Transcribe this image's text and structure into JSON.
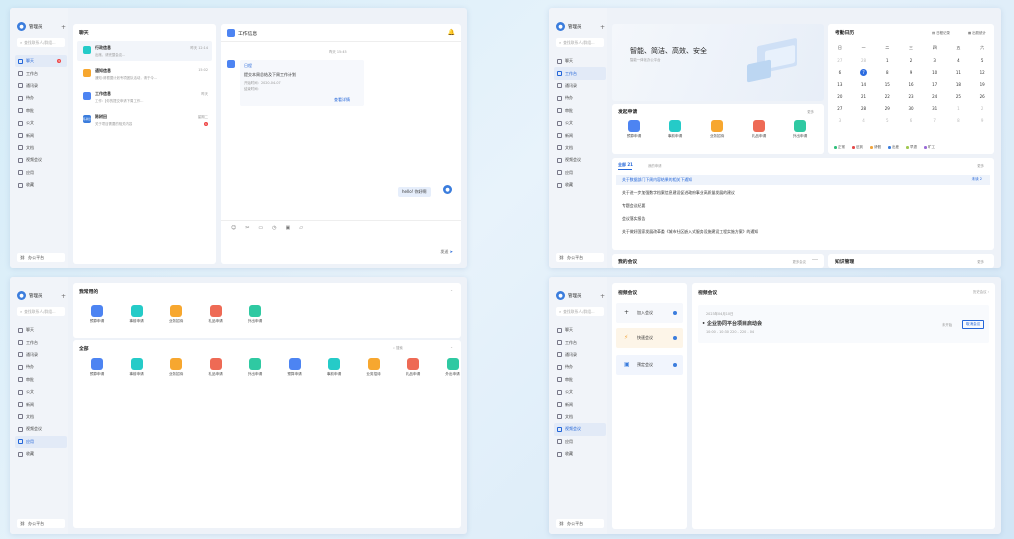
{
  "sidebar": {
    "user": "管理员",
    "search_placeholder": "查找联系人/群组...",
    "items": [
      "聊天",
      "工作台",
      "通讯录",
      "待办",
      "审批",
      "公文",
      "新闻",
      "文档",
      "视频会议",
      "应用",
      "收藏"
    ],
    "chat_badge": "3",
    "footer": "办公平台"
  },
  "chat": {
    "panel_title": "聊天",
    "list": [
      {
        "name": "行政信息",
        "preview": "出席，请完整会议...",
        "time": "昨天 12:14"
      },
      {
        "name": "通知信息",
        "preview": "通知:请根据计划专项团队活动，请于今...",
        "time": "15:02"
      },
      {
        "name": "工作信息",
        "preview": "工作:【你的提交申请下周工作...",
        "time": "昨天"
      },
      {
        "name": "陈树田",
        "preview": "关于项目需要的相关内容",
        "time": "星期二",
        "avatar": "陈树田",
        "badge": "1"
      }
    ],
    "conv_title": "工作信息",
    "timestamp": "昨天 15:45",
    "card": {
      "tag": "日程",
      "title": "提交本周总结及下周工作计划",
      "start": "开始时间：2020-04-07",
      "end": "结束时间:",
      "link": "查看详情"
    },
    "my_msg": "hello! 你好啊",
    "send": "发送"
  },
  "workbench": {
    "banner_title": "智能、简洁、高效、安全",
    "banner_sub": "智能一体化办公平台",
    "apply_title": "发起申请",
    "more": "更多",
    "apps": [
      "预算申请",
      "事前申请",
      "业务招待",
      "礼品申请",
      "外出申请"
    ],
    "calendar_title": "考勤日历",
    "cal_btn1": "日程记录",
    "cal_btn2": "出勤统计",
    "weekdays": [
      "日",
      "一",
      "二",
      "三",
      "四",
      "五",
      "六"
    ],
    "weeks": [
      [
        "27",
        "28",
        "1",
        "2",
        "3",
        "4",
        "5"
      ],
      [
        "6",
        "7",
        "8",
        "9",
        "10",
        "11",
        "12"
      ],
      [
        "13",
        "14",
        "15",
        "16",
        "17",
        "18",
        "19"
      ],
      [
        "20",
        "21",
        "22",
        "23",
        "24",
        "25",
        "26"
      ],
      [
        "27",
        "28",
        "29",
        "30",
        "31",
        "1",
        "2"
      ],
      [
        "3",
        "4",
        "5",
        "6",
        "7",
        "8",
        "9"
      ]
    ],
    "today": "7",
    "legend": [
      {
        "label": "正常",
        "color": "#2fbf7a"
      },
      {
        "label": "迟到",
        "color": "#e44a4a"
      },
      {
        "label": "请假",
        "color": "#f0a33a"
      },
      {
        "label": "出差",
        "color": "#3b7ddd"
      },
      {
        "label": "早退",
        "color": "#a0c850"
      },
      {
        "label": "旷工",
        "color": "#9a6bd8"
      }
    ],
    "tabs": [
      "全部 21",
      "我的申请"
    ],
    "announcements": [
      "关于数据部门下周内容结果的相关下通知",
      "关于进一步加强数字档案信息建设促进政府事业高质量发展的建议",
      "专题会议纪要",
      "会议落实报告",
      "关于做好国家发展改革委《城市社区嵌入式服务设施建设工程实施方案》的通知"
    ],
    "unread": "未读 2",
    "meeting_title": "我的会议",
    "meeting_more": "更多会议",
    "knowledge_title": "知识管理"
  },
  "apps_window": {
    "frequent_title": "我常用的",
    "frequent": [
      "预算申请",
      "事前申请",
      "业务招待",
      "礼品申请",
      "外出申请"
    ],
    "all_title": "全部",
    "all_search": "搜索",
    "all": [
      "预算申请",
      "事前申请",
      "业务招待",
      "礼品申请",
      "外出申请",
      "预算申请",
      "事前申请",
      "业务招待",
      "礼品申请",
      "外出申请"
    ]
  },
  "video": {
    "side_title": "视频会议",
    "actions": [
      "加入会议",
      "快速会议",
      "预定会议"
    ],
    "main_title": "视频会议",
    "history": "历史会议",
    "date": "2023年04月10日",
    "meeting_name": "企业协同平台项目启动会",
    "meeting_time": "10:00 - 10:30   220 - 220 - 04",
    "status": "未开始",
    "join": "取消会议"
  }
}
